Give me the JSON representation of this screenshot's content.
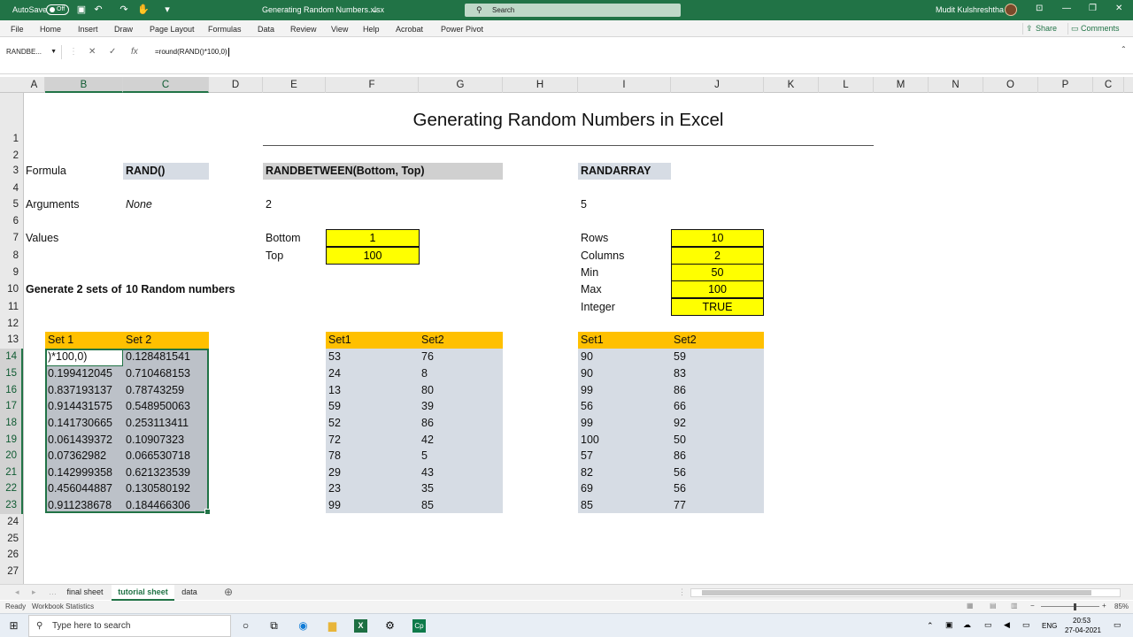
{
  "titlebar": {
    "autosave_label": "AutoSave",
    "autosave_state": "Off",
    "filename": "Generating Random Numbers.xlsx",
    "search_placeholder": "Search",
    "user_name": "Mudit Kulshreshtha"
  },
  "ribbon": {
    "tabs": [
      "File",
      "Home",
      "Insert",
      "Draw",
      "Page Layout",
      "Formulas",
      "Data",
      "Review",
      "View",
      "Help",
      "Acrobat",
      "Power Pivot"
    ],
    "share_label": "Share",
    "comments_label": "Comments"
  },
  "formula_bar": {
    "name_box": "RANDBE...",
    "formula": "=round(RAND()*100,0)"
  },
  "columns": [
    "A",
    "B",
    "C",
    "D",
    "E",
    "F",
    "G",
    "H",
    "I",
    "J",
    "K",
    "L",
    "M",
    "N",
    "O",
    "P",
    "C"
  ],
  "rows": [
    "1",
    "2",
    "3",
    "4",
    "5",
    "6",
    "7",
    "8",
    "9",
    "10",
    "11",
    "12",
    "13",
    "14",
    "15",
    "16",
    "17",
    "18",
    "19",
    "20",
    "21",
    "22",
    "23",
    "24",
    "25",
    "26",
    "27"
  ],
  "sheet": {
    "title": "Generating Random Numbers in Excel",
    "formula_label": "Formula",
    "arguments_label": "Arguments",
    "values_label": "Values",
    "generate_label": "Generate 2 sets of",
    "generate_value": "10 Random numbers",
    "rand": {
      "name": "RAND()",
      "args": "None"
    },
    "randbetween": {
      "name": "RANDBETWEEN(Bottom, Top)",
      "args": "2",
      "bottom_label": "Bottom",
      "bottom": "1",
      "top_label": "Top",
      "top": "100"
    },
    "randarray": {
      "name": "RANDARRAY",
      "args": "5",
      "rows_label": "Rows",
      "rows": "10",
      "columns_label": "Columns",
      "columns": "2",
      "min_label": "Min",
      "min": "50",
      "max_label": "Max",
      "max": "100",
      "integer_label": "Integer",
      "integer": "TRUE"
    },
    "table1": {
      "headers": [
        "Set 1",
        "Set 2"
      ],
      "rows": [
        [
          ")*100,0)",
          "0.128481541"
        ],
        [
          "0.199412045",
          "0.710468153"
        ],
        [
          "0.837193137",
          "0.78743259"
        ],
        [
          "0.914431575",
          "0.548950063"
        ],
        [
          "0.141730665",
          "0.253113411"
        ],
        [
          "0.061439372",
          "0.10907323"
        ],
        [
          "0.07362982",
          "0.066530718"
        ],
        [
          "0.142999358",
          "0.621323539"
        ],
        [
          "0.456044887",
          "0.130580192"
        ],
        [
          "0.911238678",
          "0.184466306"
        ]
      ]
    },
    "table2": {
      "headers": [
        "Set1",
        "Set2"
      ],
      "rows": [
        [
          "53",
          "76"
        ],
        [
          "24",
          "8"
        ],
        [
          "13",
          "80"
        ],
        [
          "59",
          "39"
        ],
        [
          "52",
          "86"
        ],
        [
          "72",
          "42"
        ],
        [
          "78",
          "5"
        ],
        [
          "29",
          "43"
        ],
        [
          "23",
          "35"
        ],
        [
          "99",
          "85"
        ]
      ]
    },
    "table3": {
      "headers": [
        "Set1",
        "Set2"
      ],
      "rows": [
        [
          "90",
          "59"
        ],
        [
          "90",
          "83"
        ],
        [
          "99",
          "86"
        ],
        [
          "56",
          "66"
        ],
        [
          "99",
          "92"
        ],
        [
          "100",
          "50"
        ],
        [
          "57",
          "86"
        ],
        [
          "82",
          "56"
        ],
        [
          "69",
          "56"
        ],
        [
          "85",
          "77"
        ]
      ]
    }
  },
  "sheet_tabs": [
    "final sheet",
    "tutorial sheet",
    "data"
  ],
  "active_sheet": "tutorial sheet",
  "status": {
    "ready": "Ready",
    "stats": "Workbook Statistics",
    "zoom": "85%"
  },
  "taskbar": {
    "search_placeholder": "Type here to search",
    "lang": "ENG",
    "time": "20:53",
    "date": "27-04-2021"
  },
  "colors": {
    "excel_green": "#217346",
    "yellow": "#ffff00",
    "header_orange": "#ffc000",
    "table_gray": "#d6dce4"
  }
}
